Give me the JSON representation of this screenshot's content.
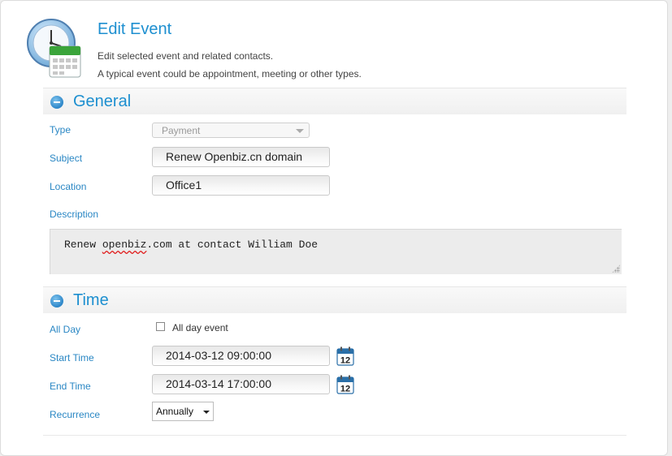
{
  "header": {
    "title": "Edit Event",
    "description_line1": "Edit selected event and related contacts.",
    "description_line2": "A typical event could be appointment, meeting or other types."
  },
  "general": {
    "section_title": "General",
    "type_label": "Type",
    "type_value": "Payment",
    "subject_label": "Subject",
    "subject_value": "Renew Openbiz.cn domain",
    "location_label": "Location",
    "location_value": "Office1",
    "description_label": "Description",
    "description_value_before": "Renew ",
    "description_value_misspelled": "openbiz",
    "description_value_after": ".com at contact William Doe"
  },
  "time": {
    "section_title": "Time",
    "allday_label": "All Day",
    "allday_checkbox_label": "All day event",
    "allday_checked": false,
    "start_label": "Start Time",
    "start_value": "2014-03-12 09:00:00",
    "end_label": "End Time",
    "end_value": "2014-03-14 17:00:00",
    "calendar_day": "12",
    "recurrence_label": "Recurrence",
    "recurrence_value": "Annually"
  },
  "colors": {
    "accent": "#1d8fd0",
    "label": "#2a87c4"
  }
}
